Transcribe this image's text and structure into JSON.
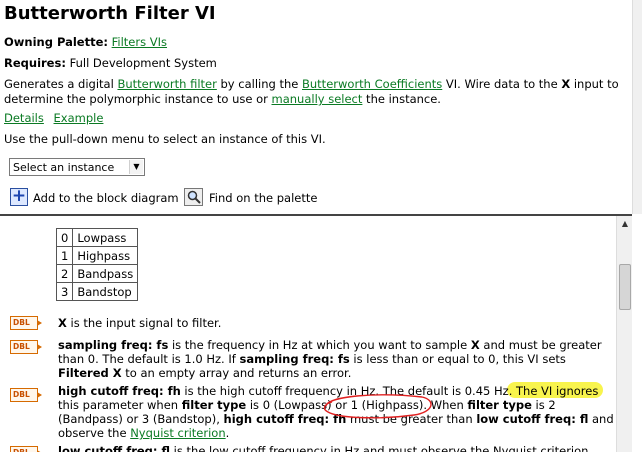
{
  "header": {
    "title": "Butterworth Filter VI",
    "owning_label": "Owning Palette:",
    "owning_link": "Filters VIs",
    "requires_label": "Requires:",
    "requires_value": "Full Development System",
    "desc_1": "Generates a digital ",
    "desc_link_1": "Butterworth filter",
    "desc_2": " by calling the ",
    "desc_link_2": "Butterworth Coefficients",
    "desc_3": " VI. Wire data to the ",
    "desc_x": "X",
    "desc_4": " input to determine the polymorphic instance to use or ",
    "desc_link_3": "manually select",
    "desc_5": " the instance.",
    "details_link": "Details",
    "example_link": "Example",
    "pulldown_text": "Use the pull-down menu to select an instance of this VI.",
    "select_value": "Select an instance",
    "add_label": "Add to the block diagram",
    "find_label": "Find on the palette"
  },
  "filter_types": [
    {
      "value": "0",
      "label": "Lowpass"
    },
    {
      "value": "1",
      "label": "Highpass"
    },
    {
      "value": "2",
      "label": "Bandpass"
    },
    {
      "value": "3",
      "label": "Bandstop"
    }
  ],
  "params": {
    "icon_label": "DBL",
    "x": {
      "name": "X",
      "text": " is the input signal to filter."
    },
    "fs": {
      "name": "sampling freq: fs",
      "t1": " is the frequency in Hz at which you want to sample ",
      "b1": "X",
      "t2": " and must be greater than 0. The default is 1.0 Hz. If ",
      "b2": "sampling freq: fs",
      "t3": " is less than or equal to 0, this VI sets ",
      "b3": "Filtered X",
      "t4": " to an empty array and returns an error."
    },
    "fh": {
      "name": "high cutoff freq: fh",
      "t1": " is the high cutoff frequency in Hz. The default is 0.45 Hz. ",
      "hl": "The VI ignores",
      "t2": " this parameter when ",
      "b1": "filter type",
      "t3": " is 0 (Lowpass) ",
      "t4": "or 1 (Highpass)",
      "t5": ". When ",
      "b2": "filter type",
      "t6": " is 2 (Bandpass) or 3 (Bandstop), ",
      "b3": "high cutoff freq: fh",
      "t7": " must be greater than ",
      "b4": "low cutoff freq: fl",
      "t8": " and observe the ",
      "link": "Nyquist criterion",
      "t9": "."
    },
    "fl": {
      "name": "low cutoff freq: fl",
      "text": " is the low cutoff frequency in Hz and must observe the Nyquist criterion"
    }
  },
  "colors": {
    "link": "#0a7a23",
    "highlight": "#f7f33a",
    "annotation": "#e02020",
    "icon": "#d66a00"
  }
}
